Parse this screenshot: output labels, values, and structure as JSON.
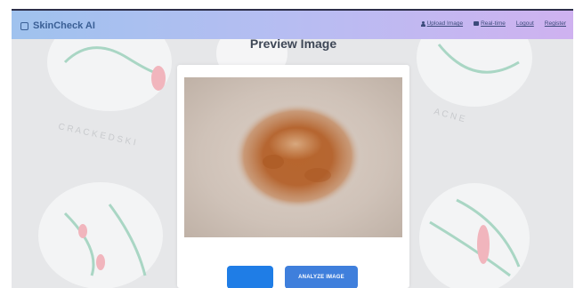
{
  "navbar": {
    "brand": "SkinCheck AI",
    "links": [
      {
        "label": "Upload Image",
        "icon": "user-icon"
      },
      {
        "label": "Real-time",
        "icon": "camera-icon"
      },
      {
        "label": "Logout"
      },
      {
        "label": "Register"
      }
    ]
  },
  "main": {
    "title": "Preview Image",
    "image_alt": "skin lesion",
    "buttons": {
      "primary": "",
      "analyze": "ANALYZE IMAGE"
    }
  },
  "colors": {
    "navbar_start": "#9fc2ee",
    "navbar_end": "#cfb2f0",
    "button_blue": "#1f7de6",
    "lesion": "#b4612a"
  }
}
